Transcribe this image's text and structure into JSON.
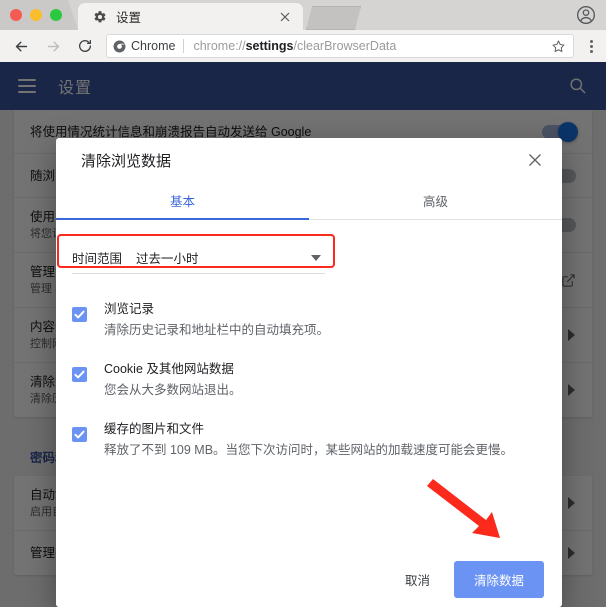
{
  "browser": {
    "tab": {
      "title": "设置",
      "favicon": "gear-icon",
      "close": "×"
    },
    "omnibox": {
      "secure_label": "Chrome",
      "url_prefix": "chrome://",
      "url_bold": "settings",
      "url_suffix": "/clearBrowserData",
      "full_url": "chrome://settings/clearBrowserData"
    }
  },
  "settings_page": {
    "title": "设置",
    "rows": [
      {
        "t1": "将使用情况统计信息和崩溃报告自动发送给 Google",
        "t2": "",
        "control": "toggle-on"
      },
      {
        "t1": "随浏览流量一起发送“不跟踪”请求",
        "t2": "",
        "control": "toggle-off"
      },
      {
        "t1": "使用网络服务以帮助解决导航错误",
        "t2": "将您访问的部分网页的网址发送给 Google",
        "control": "toggle-off"
      },
      {
        "t1": "管理证书",
        "t2": "管理 HTTPS/SSL 证书和设置",
        "control": "external-link"
      },
      {
        "t1": "内容设置",
        "t2": "控制网站可使用的信息以及可向您显示的内容",
        "control": "chevron"
      },
      {
        "t1": "清除浏览数据",
        "t2": "清除历史记录、Cookie、缓存及更多内容",
        "control": "chevron"
      }
    ],
    "section_title": "密码和表单",
    "rows2": [
      {
        "t1": "自动填充设置",
        "t2": "启用自动填充功能，只需点按一次即可填写表单",
        "control": "chevron"
      },
      {
        "t1": "管理密码",
        "t2": "",
        "control": "chevron"
      }
    ]
  },
  "dialog": {
    "title": "清除浏览数据",
    "close_label": "×",
    "tabs": [
      {
        "label": "基本",
        "active": true
      },
      {
        "label": "高级",
        "active": false
      }
    ],
    "time_range": {
      "label": "时间范围",
      "value": "过去一小时",
      "highlighted": true
    },
    "options": [
      {
        "title": "浏览记录",
        "description": "清除历史记录和地址栏中的自动填充项。",
        "checked": true
      },
      {
        "title": "Cookie 及其他网站数据",
        "description": "您会从大多数网站退出。",
        "checked": true
      },
      {
        "title": "缓存的图片和文件",
        "description": "释放了不到 109 MB。当您下次访问时，某些网站的加载速度可能会更慢。",
        "checked": true
      }
    ],
    "cancel_label": "取消",
    "confirm_label": "清除数据"
  },
  "annotations": {
    "arrow_color": "#fb2a1d",
    "highlight_color": "#fb2a1d",
    "arrow_target": "清除数据"
  },
  "colors": {
    "accent_blue": "#3b68d8",
    "button_blue": "#6a93f3",
    "header_navy": "#3b56a0",
    "checkbox_blue": "#6a93f3"
  }
}
